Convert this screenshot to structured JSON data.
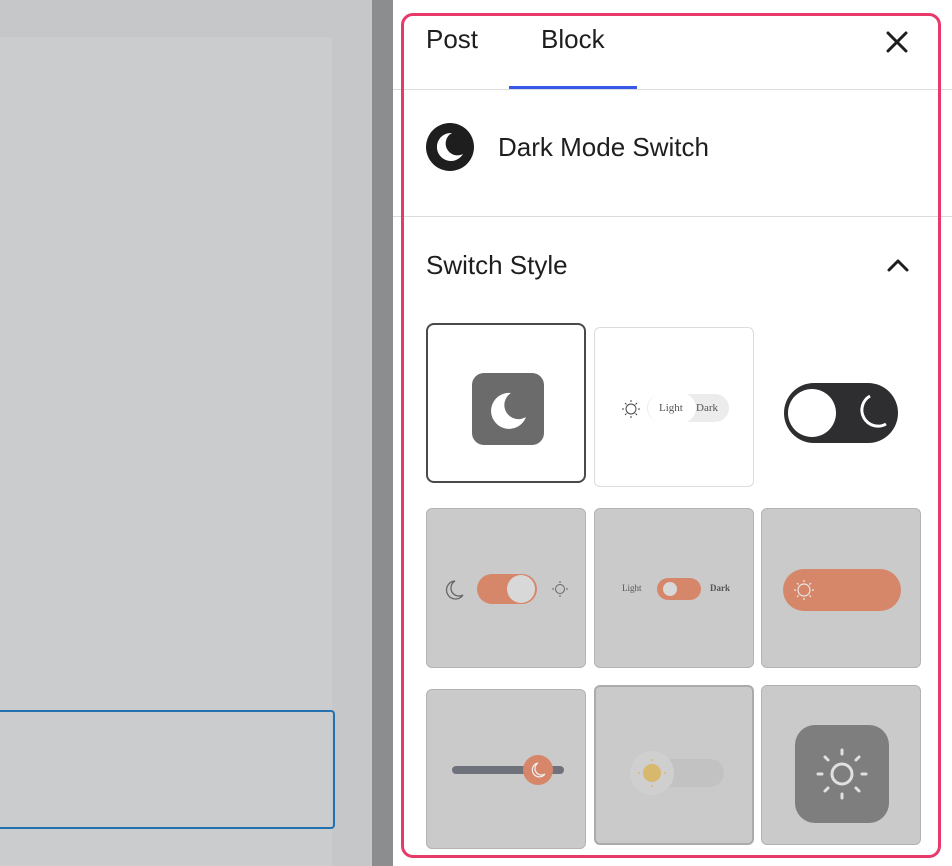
{
  "tabs": {
    "post_label": "Post",
    "block_label": "Block",
    "active": "Block"
  },
  "block": {
    "title": "Dark Mode Switch",
    "icon": "moon-icon"
  },
  "panel": {
    "title": "Switch Style",
    "expanded": true
  },
  "styles": {
    "option2": {
      "light_label": "Light",
      "dark_label": "Dark"
    },
    "option5": {
      "light_label": "Light",
      "dark_label": "Dark"
    }
  },
  "colors": {
    "accent": "#3858e9",
    "highlight": "#e83a6a",
    "toggle": "#d6876a"
  }
}
